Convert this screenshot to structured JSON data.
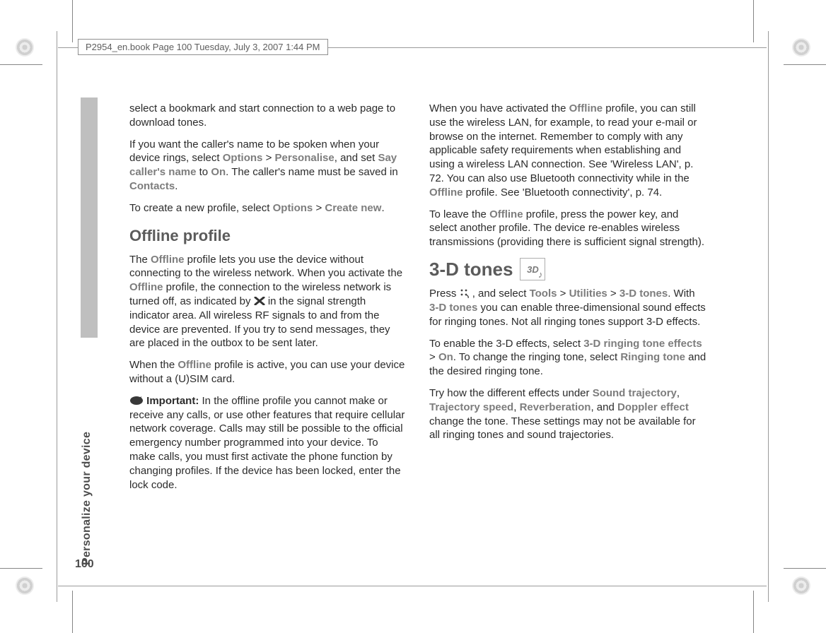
{
  "header": {
    "runhead": "P2954_en.book  Page 100  Tuesday, July 3, 2007  1:44 PM"
  },
  "side_tab": {
    "label": "Personalize your device"
  },
  "page_number": "100",
  "col1": {
    "p1": "select a bookmark and start connection to a web page to download tones.",
    "p2a": "If you want the caller's name to be spoken when your device rings, select ",
    "options": "Options",
    "gt1": " > ",
    "personalise": "Personalise",
    "p2b": ", and set ",
    "say_caller": "Say caller's name",
    "p2c": " to ",
    "on": "On",
    "p2d": ". The caller's name must be saved in ",
    "contacts": "Contacts",
    "p2e": ".",
    "p3a": "To create a new profile, select ",
    "p3b": " > ",
    "create_new": "Create new",
    "p3c": ".",
    "h_offline": "Offline profile",
    "p4a": "The ",
    "offline": "Offline",
    "p4b": " profile lets you use the device without connecting to the wireless network. When you activate the ",
    "p4c": " profile, the connection to the wireless network is turned off, as indicated by ",
    "p4d": " in the signal strength indicator area. All wireless RF signals to and from the device are prevented. If you try to send messages, they are placed in the outbox to be sent later.",
    "p5a": "When the ",
    "p5b": " profile is active, you can use your device without a (U)SIM card.",
    "important_label": "Important:",
    "p6": " In the offline profile you cannot make or receive any calls, or use other features that require cellular network coverage. Calls may still be possible to the official emergency number programmed into your device. To make calls, you must first activate the phone function by changing profiles. If the device has been locked, enter the lock code."
  },
  "col2": {
    "p1a": "When you have activated the ",
    "p1b": " profile, you can still use the wireless LAN, for example, to read your e-mail or browse on the internet. Remember to comply with any applicable safety requirements when establishing and using a wireless LAN connection. See 'Wireless LAN', p. 72. You can also use Bluetooth connectivity while in the ",
    "p1c": " profile. See 'Bluetooth connectivity', p. 74.",
    "p2a": "To leave the ",
    "p2b": " profile, press the power key, and select another profile. The device re-enables wireless transmissions (providing there is sufficient signal strength).",
    "h_3d": "3-D tones",
    "p3a": "Press ",
    "p3b": ", and select ",
    "tools": "Tools",
    "gt": " > ",
    "utilities": "Utilities",
    "tones3d": "3-D tones",
    "p3c": ". With ",
    "p3d": " you can enable three-dimensional sound effects for ringing tones. Not all ringing tones support 3-D effects.",
    "p4a": "To enable the 3-D effects, select ",
    "ring_eff": "3-D ringing tone effects",
    "p4b": " > ",
    "on": "On",
    "p4c": ". To change the ringing tone, select ",
    "ringing_tone": "Ringing tone",
    "p4d": " and the desired ringing tone.",
    "p5a": "Try how the different effects under ",
    "sound_traj": "Sound trajectory",
    "comma1": ", ",
    "traj_speed": "Trajectory speed",
    "comma2": ", ",
    "reverb": "Reverberation",
    "p5b": ", and ",
    "doppler": "Doppler effect",
    "p5c": " change the tone. These settings may not be available for all ringing tones and sound trajectories."
  },
  "icons": {
    "x": "no-signal-x-icon",
    "menu": "menu-key-icon",
    "important": "important-icon",
    "threeD": "3d-tones-icon"
  }
}
